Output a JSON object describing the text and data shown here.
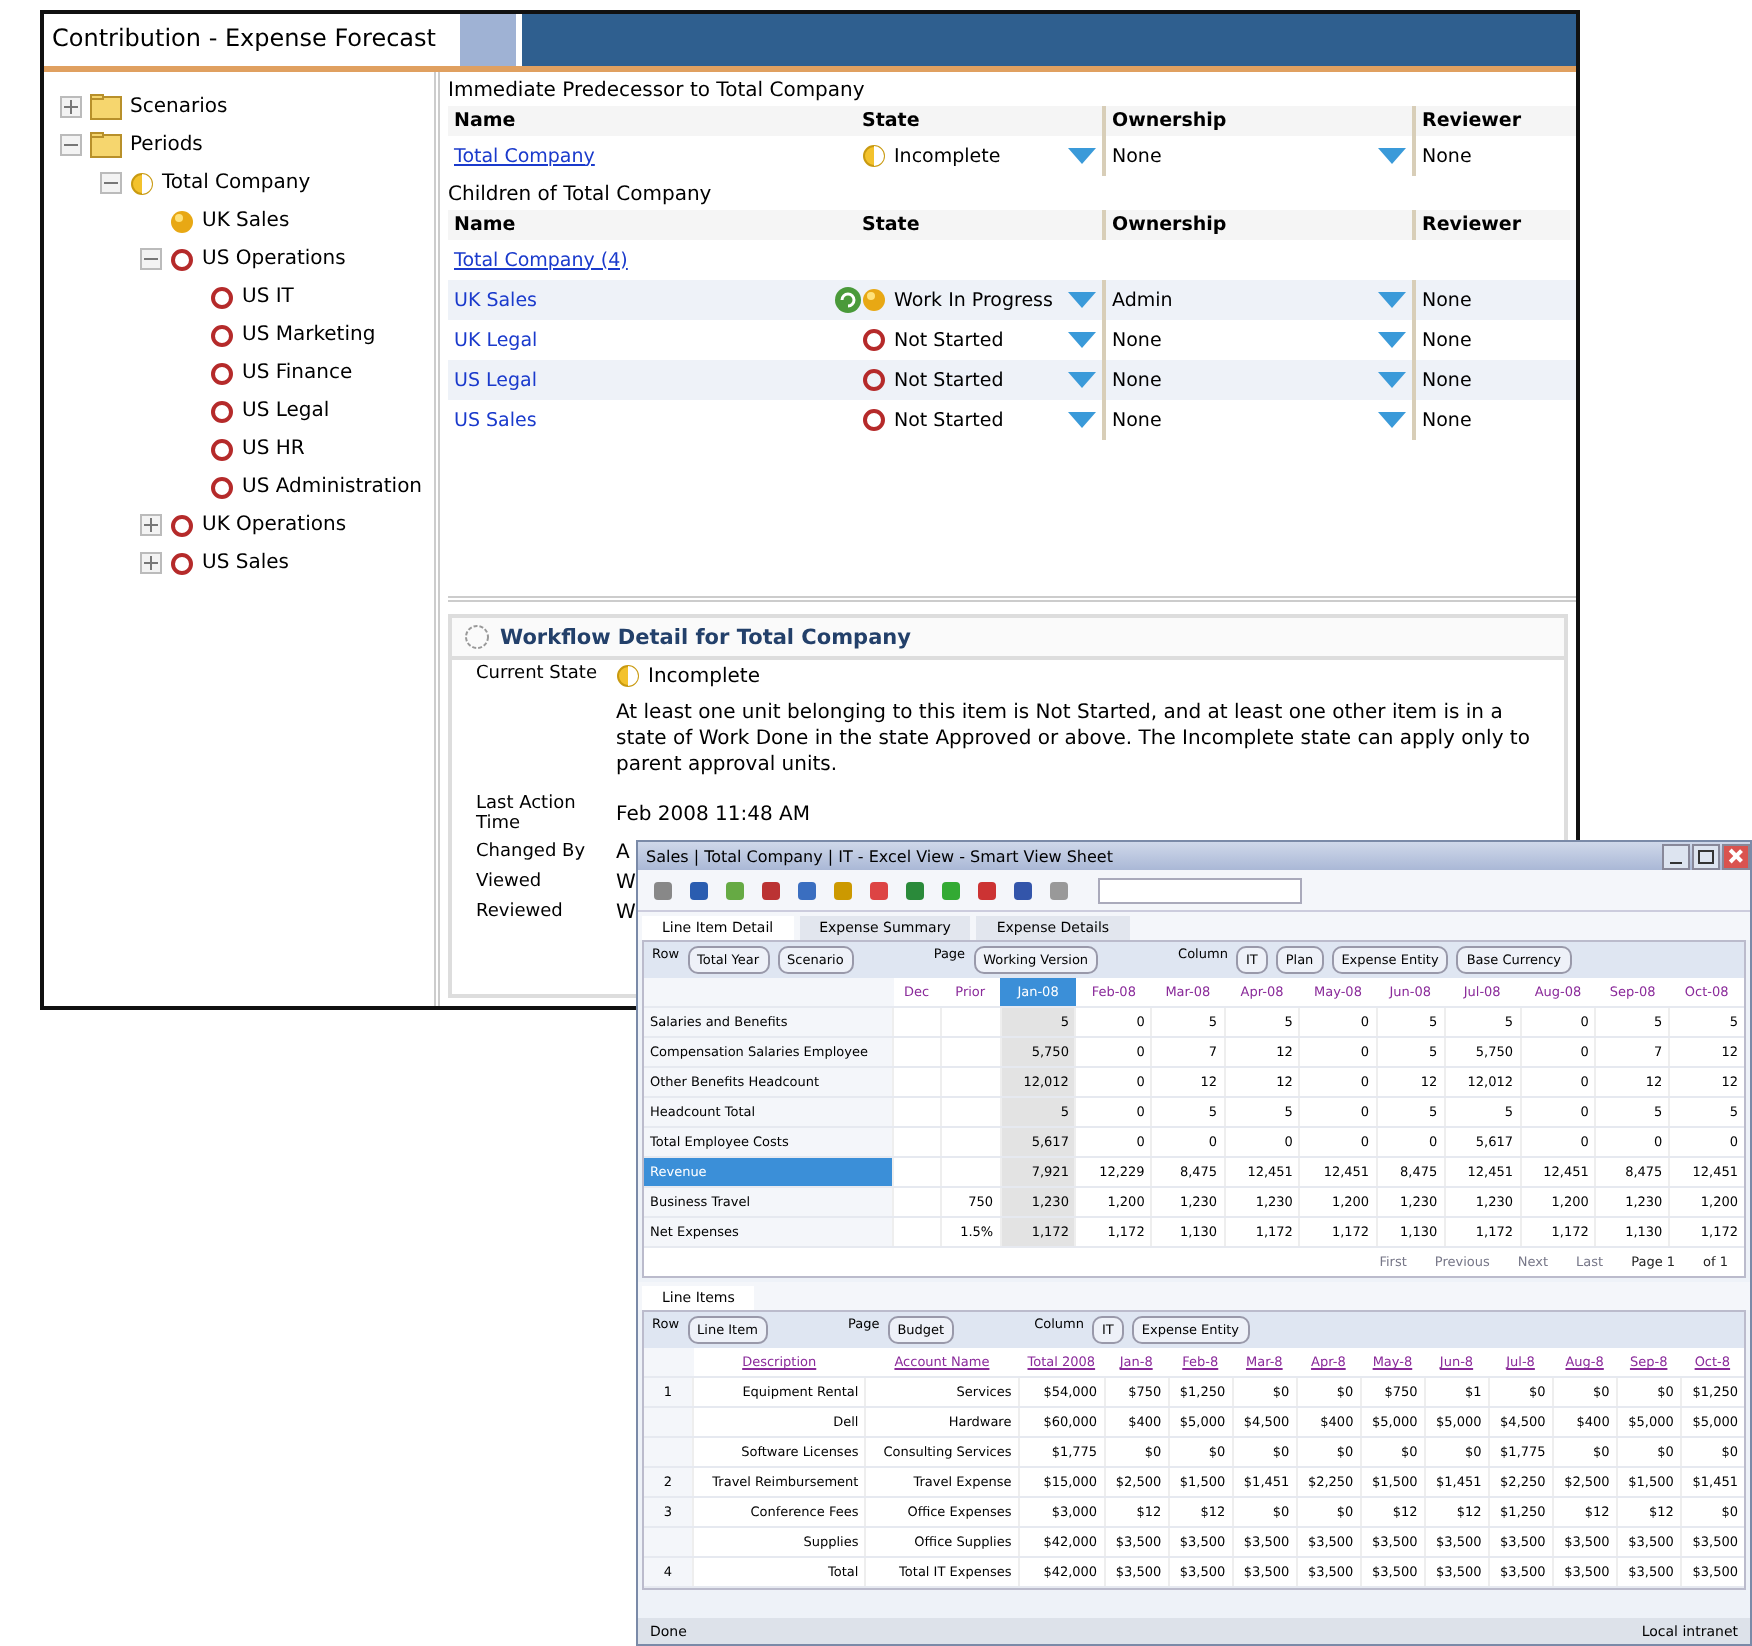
{
  "back_window": {
    "title": "Contribution - Expense Forecast"
  },
  "tree": [
    {
      "label": "Scenarios",
      "kind": "folder",
      "expanded": false
    },
    {
      "label": "Periods",
      "kind": "folder",
      "expanded": true,
      "children": [
        {
          "label": "Total Company",
          "kind": "partial",
          "expanded": true,
          "children": [
            {
              "label": "UK Sales",
              "kind": "progress"
            },
            {
              "label": "US Operations",
              "kind": "not_started",
              "expanded": true,
              "children": [
                {
                  "label": "US IT",
                  "kind": "not_started"
                },
                {
                  "label": "US Marketing",
                  "kind": "not_started"
                },
                {
                  "label": "US Finance",
                  "kind": "not_started"
                },
                {
                  "label": "US Legal",
                  "kind": "not_started"
                },
                {
                  "label": "US HR",
                  "kind": "not_started"
                },
                {
                  "label": "US Administration",
                  "kind": "not_started"
                }
              ]
            },
            {
              "label": "UK Operations",
              "kind": "not_started",
              "expanded": false
            },
            {
              "label": "US Sales",
              "kind": "not_started",
              "expanded": false
            }
          ]
        }
      ]
    }
  ],
  "sections": [
    {
      "caption": "Immediate Predecessor to Total Company",
      "columns": [
        "Name",
        "State",
        "Ownership",
        "Reviewer"
      ],
      "rows": [
        {
          "name": "Total Company",
          "link": true,
          "state": {
            "kind": "partial",
            "text": "Incomplete"
          },
          "ownership": "None",
          "reviewer": "None",
          "busy": false
        }
      ]
    },
    {
      "caption": "Children of Total Company",
      "columns": [
        "Name",
        "State",
        "Ownership",
        "Reviewer"
      ],
      "group_link": "Total Company (4)",
      "rows": [
        {
          "name": "UK Sales",
          "link": false,
          "state": {
            "kind": "progress",
            "text": "Work In Progress"
          },
          "ownership": "Admin",
          "reviewer": "None",
          "busy": true
        },
        {
          "name": "UK Legal",
          "link": false,
          "state": {
            "kind": "not_started",
            "text": "Not Started"
          },
          "ownership": "None",
          "reviewer": "None",
          "busy": false
        },
        {
          "name": "US Legal",
          "link": false,
          "state": {
            "kind": "not_started",
            "text": "Not Started"
          },
          "ownership": "None",
          "reviewer": "None",
          "busy": false
        },
        {
          "name": "US Sales",
          "link": false,
          "state": {
            "kind": "not_started",
            "text": "Not Started"
          },
          "ownership": "None",
          "reviewer": "None",
          "busy": false
        }
      ]
    }
  ],
  "detail": {
    "title": "Workflow Detail for Total Company",
    "state_label": "Current State",
    "state": {
      "kind": "partial",
      "text": "Incomplete"
    },
    "description": "At least one unit belonging to this item is Not Started, and at least one other item is in a state of Work Done in the state Approved or above. The Incomplete state can apply only to parent approval units.",
    "fields": [
      {
        "label": "Last Action Time",
        "value": "Feb 2008 11:48 AM"
      },
      {
        "label": "Changed By",
        "value": "A"
      },
      {
        "label": "Viewed",
        "value": "W"
      },
      {
        "label": "Reviewed",
        "value": "W"
      }
    ]
  },
  "front_window": {
    "title": "Sales | Total Company | IT - Excel View - Smart View Sheet",
    "tabs": [
      {
        "label": "Line Item Detail",
        "selected": true
      },
      {
        "label": "Expense Summary",
        "selected": false
      },
      {
        "label": "Expense Details",
        "selected": false
      }
    ],
    "top_grid": {
      "filters": [
        {
          "group": "Row",
          "items": [
            "Total Year",
            "Scenario"
          ]
        },
        {
          "group": "Page",
          "items": [
            "Working Version"
          ]
        },
        {
          "group": "Column",
          "items": [
            "IT",
            "Plan",
            "Expense Entity",
            "Base Currency"
          ]
        }
      ],
      "columns": [
        {
          "label": "Dec",
          "selected": false
        },
        {
          "label": "Prior",
          "selected": false
        },
        {
          "label": "Jan-08",
          "selected": true
        },
        {
          "label": "Feb-08",
          "selected": false
        },
        {
          "label": "Mar-08",
          "selected": false
        },
        {
          "label": "Apr-08",
          "selected": false
        },
        {
          "label": "May-08",
          "selected": false
        },
        {
          "label": "Jun-08",
          "selected": false
        },
        {
          "label": "Jul-08",
          "selected": false
        },
        {
          "label": "Aug-08",
          "selected": false
        },
        {
          "label": "Sep-08",
          "selected": false
        },
        {
          "label": "Oct-08",
          "selected": false
        }
      ],
      "rows": [
        {
          "label": "Salaries and Benefits",
          "selected": false,
          "cells": [
            "",
            "",
            "5",
            "0",
            "5",
            "5",
            "0",
            "5",
            "5",
            "0",
            "5",
            "5"
          ]
        },
        {
          "label": "Compensation Salaries Employee",
          "selected": false,
          "cells": [
            "",
            "",
            "5,750",
            "0",
            "7",
            "12",
            "0",
            "5",
            "5,750",
            "0",
            "7",
            "12"
          ]
        },
        {
          "label": "Other Benefits Headcount",
          "selected": false,
          "cells": [
            "",
            "",
            "12,012",
            "0",
            "12",
            "12",
            "0",
            "12",
            "12,012",
            "0",
            "12",
            "12"
          ]
        },
        {
          "label": "Headcount Total",
          "selected": false,
          "cells": [
            "",
            "",
            "5",
            "0",
            "5",
            "5",
            "0",
            "5",
            "5",
            "0",
            "5",
            "5"
          ]
        },
        {
          "label": "Total Employee Costs",
          "selected": false,
          "cells": [
            "",
            "",
            "5,617",
            "0",
            "0",
            "0",
            "0",
            "0",
            "5,617",
            "0",
            "0",
            "0"
          ]
        },
        {
          "label": "Revenue",
          "selected": true,
          "cells": [
            "",
            "",
            "7,921",
            "12,229",
            "8,475",
            "12,451",
            "12,451",
            "8,475",
            "12,451",
            "12,451",
            "8,475",
            "12,451"
          ]
        },
        {
          "label": "Business Travel",
          "selected": false,
          "cells": [
            "",
            "750",
            "1,230",
            "1,200",
            "1,230",
            "1,230",
            "1,200",
            "1,230",
            "1,230",
            "1,200",
            "1,230",
            "1,200"
          ]
        },
        {
          "label": "Net Expenses",
          "selected": false,
          "cells": [
            "",
            "1.5%",
            "1,172",
            "1,172",
            "1,130",
            "1,172",
            "1,172",
            "1,130",
            "1,172",
            "1,172",
            "1,130",
            "1,172"
          ]
        }
      ]
    },
    "lower_tab": "Line Items",
    "lower_grid": {
      "filters": [
        {
          "group": "Row",
          "items": [
            "Line Item"
          ]
        },
        {
          "group": "Page",
          "items": [
            "Budget"
          ]
        },
        {
          "group": "Column",
          "items": [
            "IT",
            "Expense Entity"
          ]
        }
      ],
      "head": [
        "Description",
        "Account Name",
        "Total 2008"
      ],
      "months": [
        "Jan-8",
        "Feb-8",
        "Mar-8",
        "Apr-8",
        "May-8",
        "Jun-8",
        "Jul-8",
        "Aug-8",
        "Sep-8",
        "Oct-8"
      ],
      "rows": [
        {
          "num": "1",
          "cells": [
            "Equipment Rental",
            "Services",
            "$54,000",
            "$750",
            "$1,250",
            "$0",
            "$0",
            "$750",
            "$1",
            "$0",
            "$0",
            "$0",
            "$1,250"
          ]
        },
        {
          "num": "",
          "cells": [
            "Dell",
            "Hardware",
            "$60,000",
            "$400",
            "$5,000",
            "$4,500",
            "$400",
            "$5,000",
            "$5,000",
            "$4,500",
            "$400",
            "$5,000",
            "$5,000"
          ]
        },
        {
          "num": "",
          "cells": [
            "Software Licenses",
            "Consulting Services",
            "$1,775",
            "$0",
            "$0",
            "$0",
            "$0",
            "$0",
            "$0",
            "$1,775",
            "$0",
            "$0",
            "$0"
          ]
        },
        {
          "num": "2",
          "cells": [
            "Travel Reimbursement",
            "Travel Expense",
            "$15,000",
            "$2,500",
            "$1,500",
            "$1,451",
            "$2,250",
            "$1,500",
            "$1,451",
            "$2,250",
            "$2,500",
            "$1,500",
            "$1,451"
          ]
        },
        {
          "num": "3",
          "cells": [
            "Conference Fees",
            "Office Expenses",
            "$3,000",
            "$12",
            "$12",
            "$0",
            "$0",
            "$12",
            "$12",
            "$1,250",
            "$12",
            "$12",
            "$0"
          ]
        },
        {
          "num": "",
          "cells": [
            "Supplies",
            "Office Supplies",
            "$42,000",
            "$3,500",
            "$3,500",
            "$3,500",
            "$3,500",
            "$3,500",
            "$3,500",
            "$3,500",
            "$3,500",
            "$3,500",
            "$3,500"
          ]
        },
        {
          "num": "4",
          "cells": [
            "Total",
            "Total IT Expenses",
            "$42,000",
            "$3,500",
            "$3,500",
            "$3,500",
            "$3,500",
            "$3,500",
            "$3,500",
            "$3,500",
            "$3,500",
            "$3,500",
            "$3,500"
          ]
        }
      ]
    },
    "pager": [
      "First",
      "Previous",
      "Next",
      "Last"
    ],
    "page": "Page 1",
    "page_total": "of 1",
    "status": "Done",
    "status_right": "Local intranet"
  }
}
